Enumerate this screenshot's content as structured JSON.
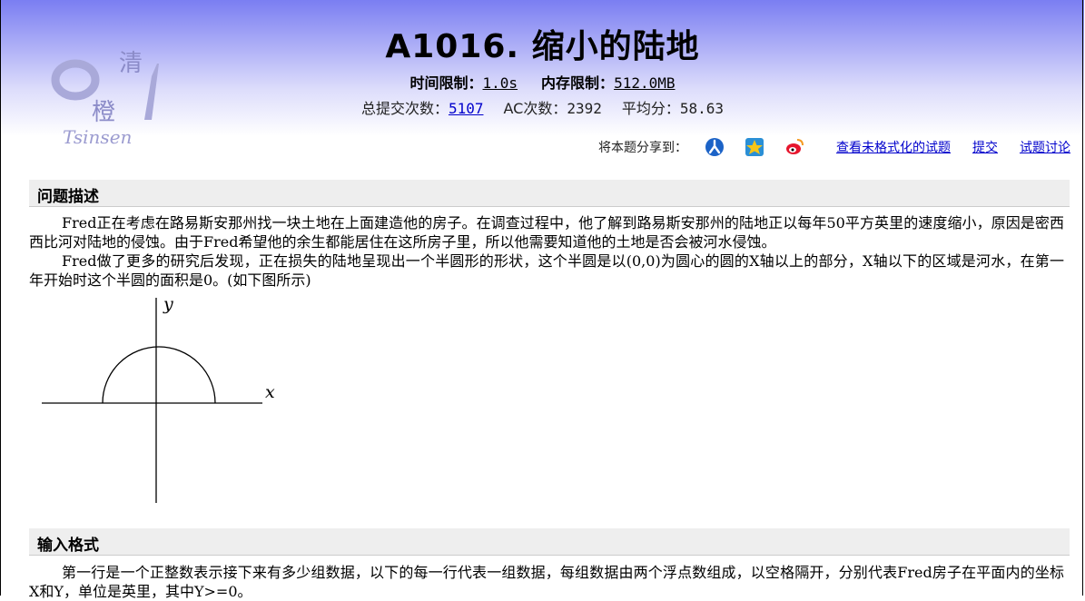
{
  "problem": {
    "title": "A1016.  缩小的陆地",
    "time_limit_label": "时间限制：",
    "time_limit_value": "1.0s",
    "memory_limit_label": "内存限制：",
    "memory_limit_value": "512.0MB",
    "submissions_label": "总提交次数：",
    "submissions_value": "5107",
    "ac_label": "AC次数：",
    "ac_value": "2392",
    "avg_label": "平均分：",
    "avg_value": "58.63"
  },
  "logo": {
    "char1": "清",
    "char2": "橙",
    "digits": "01",
    "text": "Tsinsen"
  },
  "share": {
    "label": "将本题分享到：",
    "icons": [
      "renren-icon",
      "qzone-icon",
      "weibo-icon"
    ],
    "links": [
      "查看未格式化的试题",
      "提交",
      "试题讨论"
    ]
  },
  "sections": {
    "description_title": "问题描述",
    "description_p1": "Fred正在考虑在路易斯安那州找一块土地在上面建造他的房子。在调查过程中，他了解到路易斯安那州的陆地正以每年50平方英里的速度缩小，原因是密西西比河对陆地的侵蚀。由于Fred希望他的余生都能居住在这所房子里，所以他需要知道他的土地是否会被河水侵蚀。",
    "description_p2": "Fred做了更多的研究后发现，正在损失的陆地呈现出一个半圆形的形状，这个半圆是以(0,0)为圆心的圆的X轴以上的部分，X轴以下的区域是河水，在第一年开始时这个半圆的面积是0。(如下图所示)",
    "figure_x_label": "x",
    "figure_y_label": "y",
    "input_title": "输入格式",
    "input_p1": "第一行是一个正整数表示接下来有多少组数据，以下的每一行代表一组数据，每组数据由两个浮点数组成，以空格隔开，分别代表Fred房子在平面内的坐标X和Y，单位是英里，其中Y>=0。"
  },
  "colors": {
    "header_top": "#7a7ef2",
    "link": "#0000cc",
    "section_bg": "#eeeeee"
  }
}
